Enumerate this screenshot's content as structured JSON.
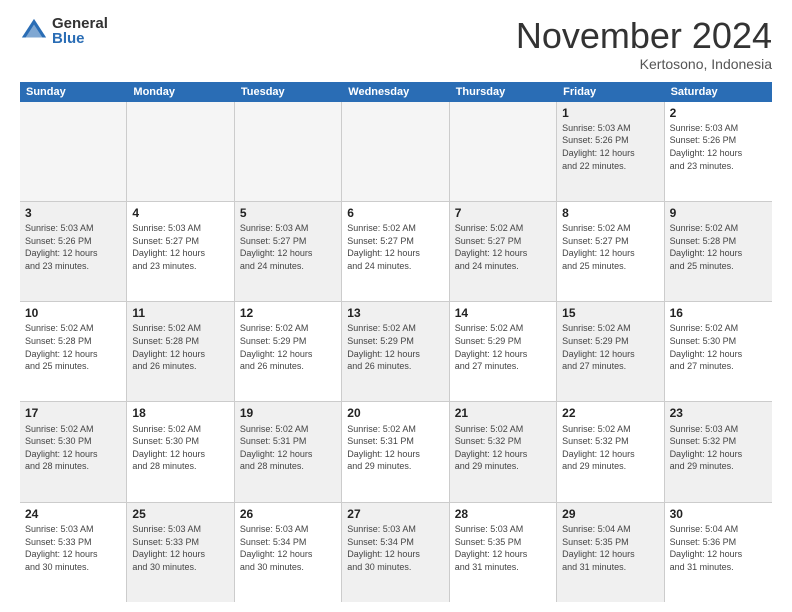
{
  "logo": {
    "general": "General",
    "blue": "Blue"
  },
  "title": "November 2024",
  "location": "Kertosono, Indonesia",
  "header_days": [
    "Sunday",
    "Monday",
    "Tuesday",
    "Wednesday",
    "Thursday",
    "Friday",
    "Saturday"
  ],
  "weeks": [
    [
      {
        "day": "",
        "info": "",
        "empty": true
      },
      {
        "day": "",
        "info": "",
        "empty": true
      },
      {
        "day": "",
        "info": "",
        "empty": true
      },
      {
        "day": "",
        "info": "",
        "empty": true
      },
      {
        "day": "",
        "info": "",
        "empty": true
      },
      {
        "day": "1",
        "info": "Sunrise: 5:03 AM\nSunset: 5:26 PM\nDaylight: 12 hours\nand 22 minutes.",
        "shaded": true
      },
      {
        "day": "2",
        "info": "Sunrise: 5:03 AM\nSunset: 5:26 PM\nDaylight: 12 hours\nand 23 minutes.",
        "shaded": false
      }
    ],
    [
      {
        "day": "3",
        "info": "Sunrise: 5:03 AM\nSunset: 5:26 PM\nDaylight: 12 hours\nand 23 minutes.",
        "shaded": true
      },
      {
        "day": "4",
        "info": "Sunrise: 5:03 AM\nSunset: 5:27 PM\nDaylight: 12 hours\nand 23 minutes.",
        "shaded": false
      },
      {
        "day": "5",
        "info": "Sunrise: 5:03 AM\nSunset: 5:27 PM\nDaylight: 12 hours\nand 24 minutes.",
        "shaded": true
      },
      {
        "day": "6",
        "info": "Sunrise: 5:02 AM\nSunset: 5:27 PM\nDaylight: 12 hours\nand 24 minutes.",
        "shaded": false
      },
      {
        "day": "7",
        "info": "Sunrise: 5:02 AM\nSunset: 5:27 PM\nDaylight: 12 hours\nand 24 minutes.",
        "shaded": true
      },
      {
        "day": "8",
        "info": "Sunrise: 5:02 AM\nSunset: 5:27 PM\nDaylight: 12 hours\nand 25 minutes.",
        "shaded": false
      },
      {
        "day": "9",
        "info": "Sunrise: 5:02 AM\nSunset: 5:28 PM\nDaylight: 12 hours\nand 25 minutes.",
        "shaded": true
      }
    ],
    [
      {
        "day": "10",
        "info": "Sunrise: 5:02 AM\nSunset: 5:28 PM\nDaylight: 12 hours\nand 25 minutes.",
        "shaded": false
      },
      {
        "day": "11",
        "info": "Sunrise: 5:02 AM\nSunset: 5:28 PM\nDaylight: 12 hours\nand 26 minutes.",
        "shaded": true
      },
      {
        "day": "12",
        "info": "Sunrise: 5:02 AM\nSunset: 5:29 PM\nDaylight: 12 hours\nand 26 minutes.",
        "shaded": false
      },
      {
        "day": "13",
        "info": "Sunrise: 5:02 AM\nSunset: 5:29 PM\nDaylight: 12 hours\nand 26 minutes.",
        "shaded": true
      },
      {
        "day": "14",
        "info": "Sunrise: 5:02 AM\nSunset: 5:29 PM\nDaylight: 12 hours\nand 27 minutes.",
        "shaded": false
      },
      {
        "day": "15",
        "info": "Sunrise: 5:02 AM\nSunset: 5:29 PM\nDaylight: 12 hours\nand 27 minutes.",
        "shaded": true
      },
      {
        "day": "16",
        "info": "Sunrise: 5:02 AM\nSunset: 5:30 PM\nDaylight: 12 hours\nand 27 minutes.",
        "shaded": false
      }
    ],
    [
      {
        "day": "17",
        "info": "Sunrise: 5:02 AM\nSunset: 5:30 PM\nDaylight: 12 hours\nand 28 minutes.",
        "shaded": true
      },
      {
        "day": "18",
        "info": "Sunrise: 5:02 AM\nSunset: 5:30 PM\nDaylight: 12 hours\nand 28 minutes.",
        "shaded": false
      },
      {
        "day": "19",
        "info": "Sunrise: 5:02 AM\nSunset: 5:31 PM\nDaylight: 12 hours\nand 28 minutes.",
        "shaded": true
      },
      {
        "day": "20",
        "info": "Sunrise: 5:02 AM\nSunset: 5:31 PM\nDaylight: 12 hours\nand 29 minutes.",
        "shaded": false
      },
      {
        "day": "21",
        "info": "Sunrise: 5:02 AM\nSunset: 5:32 PM\nDaylight: 12 hours\nand 29 minutes.",
        "shaded": true
      },
      {
        "day": "22",
        "info": "Sunrise: 5:02 AM\nSunset: 5:32 PM\nDaylight: 12 hours\nand 29 minutes.",
        "shaded": false
      },
      {
        "day": "23",
        "info": "Sunrise: 5:03 AM\nSunset: 5:32 PM\nDaylight: 12 hours\nand 29 minutes.",
        "shaded": true
      }
    ],
    [
      {
        "day": "24",
        "info": "Sunrise: 5:03 AM\nSunset: 5:33 PM\nDaylight: 12 hours\nand 30 minutes.",
        "shaded": false
      },
      {
        "day": "25",
        "info": "Sunrise: 5:03 AM\nSunset: 5:33 PM\nDaylight: 12 hours\nand 30 minutes.",
        "shaded": true
      },
      {
        "day": "26",
        "info": "Sunrise: 5:03 AM\nSunset: 5:34 PM\nDaylight: 12 hours\nand 30 minutes.",
        "shaded": false
      },
      {
        "day": "27",
        "info": "Sunrise: 5:03 AM\nSunset: 5:34 PM\nDaylight: 12 hours\nand 30 minutes.",
        "shaded": true
      },
      {
        "day": "28",
        "info": "Sunrise: 5:03 AM\nSunset: 5:35 PM\nDaylight: 12 hours\nand 31 minutes.",
        "shaded": false
      },
      {
        "day": "29",
        "info": "Sunrise: 5:04 AM\nSunset: 5:35 PM\nDaylight: 12 hours\nand 31 minutes.",
        "shaded": true
      },
      {
        "day": "30",
        "info": "Sunrise: 5:04 AM\nSunset: 5:36 PM\nDaylight: 12 hours\nand 31 minutes.",
        "shaded": false
      }
    ]
  ]
}
